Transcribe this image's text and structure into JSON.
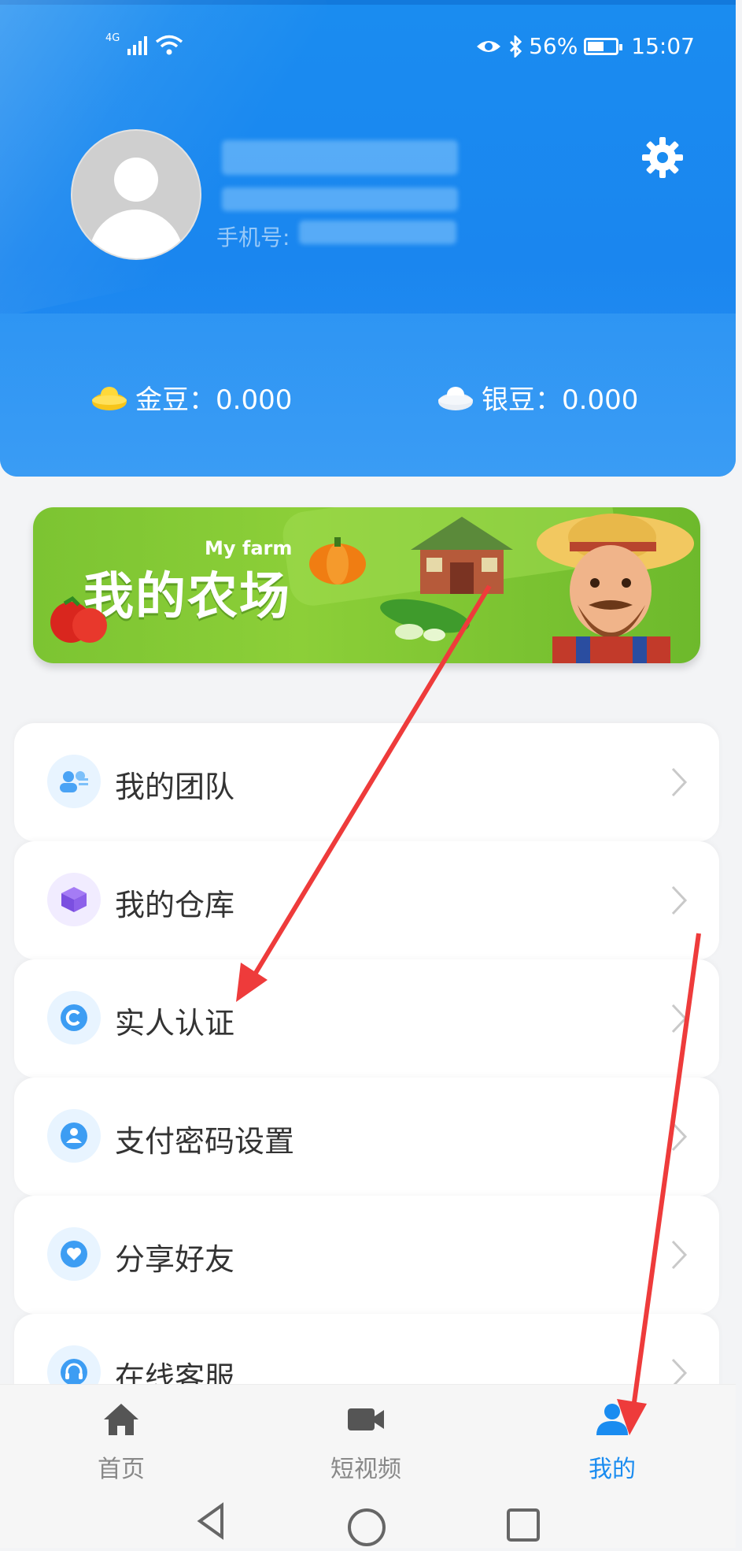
{
  "status_bar": {
    "network": "4G",
    "battery": "56%",
    "time": "15:07"
  },
  "profile": {
    "avatar": "default-avatar",
    "phone_label": "手机号:"
  },
  "beans": {
    "gold_label": "金豆",
    "gold_value": "0.000",
    "silver_label": "银豆",
    "silver_value": "0.000"
  },
  "banner": {
    "subtitle": "My farm",
    "title": "我的农场"
  },
  "menu": {
    "items": [
      {
        "label": "我的团队",
        "icon": "team-icon"
      },
      {
        "label": "我的仓库",
        "icon": "warehouse-icon"
      },
      {
        "label": "实人认证",
        "icon": "verify-icon"
      },
      {
        "label": "支付密码设置",
        "icon": "payment-password-icon"
      },
      {
        "label": "分享好友",
        "icon": "share-icon"
      },
      {
        "label": "在线客服",
        "icon": "customer-service-icon"
      }
    ]
  },
  "tabbar": {
    "items": [
      {
        "label": "首页",
        "icon": "home-icon"
      },
      {
        "label": "短视频",
        "icon": "video-icon"
      },
      {
        "label": "我的",
        "icon": "user-icon",
        "active": true
      }
    ]
  },
  "colors": {
    "brand": "#1a8cf0",
    "annotation_arrow": "#ee3b3b"
  }
}
